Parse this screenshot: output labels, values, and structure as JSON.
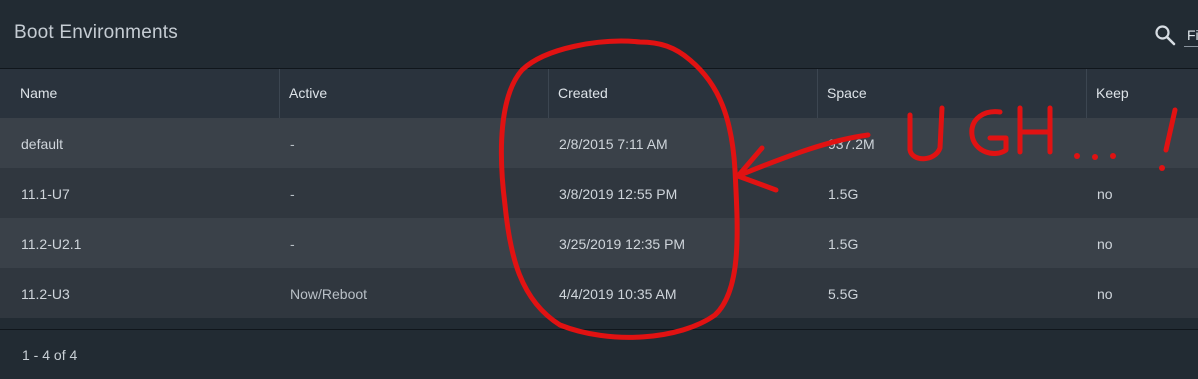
{
  "header": {
    "title": "Boot Environments",
    "filter_placeholder": "Fi"
  },
  "table": {
    "columns": [
      "Name",
      "Active",
      "Created",
      "Space",
      "Keep"
    ],
    "rows": [
      {
        "name": "default",
        "active": "-",
        "created": "2/8/2015 7:11 AM",
        "space": "937.2M",
        "keep": ""
      },
      {
        "name": "11.1-U7",
        "active": "-",
        "created": "3/8/2019 12:55 PM",
        "space": "1.5G",
        "keep": "no"
      },
      {
        "name": "11.2-U2.1",
        "active": "-",
        "created": "3/25/2019 12:35 PM",
        "space": "1.5G",
        "keep": "no"
      },
      {
        "name": "11.2-U3",
        "active": "Now/Reboot",
        "created": "4/4/2019 10:35 AM",
        "space": "5.5G",
        "keep": "no"
      }
    ]
  },
  "footer": {
    "range": "1 - 4 of 4"
  },
  "annotation": {
    "text": "UGH... !",
    "color": "#e11212",
    "shapes": [
      "circle-around-created-column",
      "arrow-to-created",
      "handwritten-ugh"
    ]
  },
  "colors": {
    "background": "#222b33",
    "header_row": "#2a333d",
    "row_odd": "#3a4149",
    "row_even": "#30373f",
    "annotation_red": "#e11212"
  }
}
